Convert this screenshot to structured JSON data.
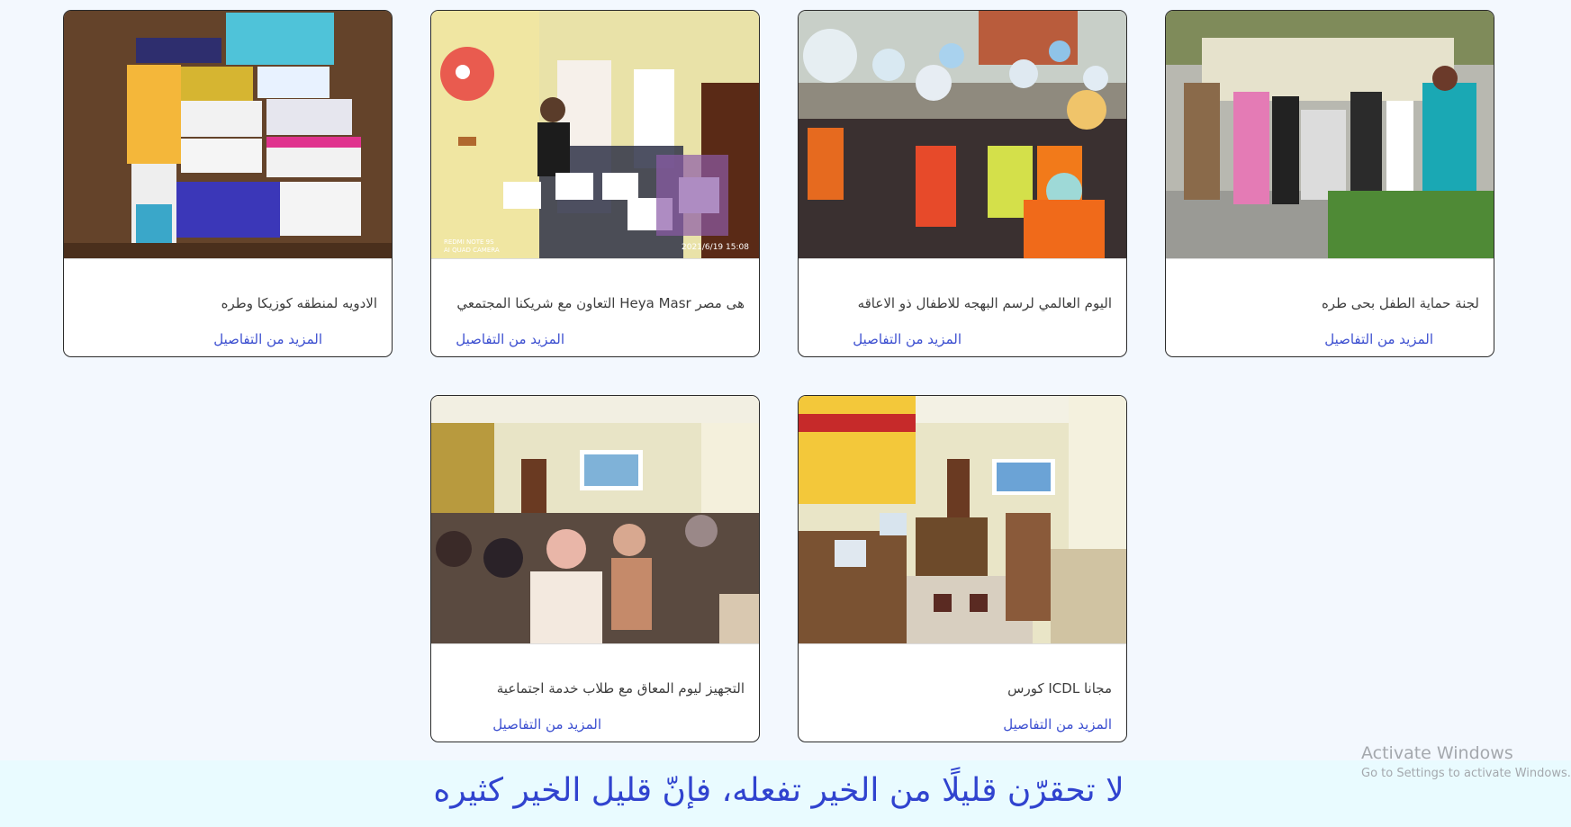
{
  "cards": [
    {
      "title": "الادويه لمنطقه كوزيكا وطره",
      "more_label": "المزيد من التفاصيل",
      "image": "medicine-boxes-photo"
    },
    {
      "title": "هى مصر Heya Masr التعاون مع شريكنا المجتمعي",
      "more_label": "المزيد من التفاصيل",
      "image": "children-certificates-photo",
      "photo_stamp_left": "REDMI NOTE 9S\nAI QUAD CAMERA",
      "photo_stamp_right": "2021/6/19 15:08"
    },
    {
      "title": "اليوم العالمي لرسم البهجه للاطفال ذو الاعاقه",
      "more_label": "المزيد من التفاصيل",
      "image": "balloons-celebration-photo"
    },
    {
      "title": "لجنة حماية الطفل بحى طره",
      "more_label": "المزيد من التفاصيل",
      "image": "committee-group-photo"
    },
    {
      "title": "التجهيز ليوم المعاق مع طلاب خدمة اجتماعية",
      "more_label": "المزيد من التفاصيل",
      "image": "students-lecture-photo"
    },
    {
      "title": "مجانا ICDL كورس",
      "more_label": "المزيد من التفاصيل",
      "image": "computer-lab-photo"
    }
  ],
  "footer": {
    "quote": "لا تحقرّن قليلًا من الخير تفعله، فإنّ قليل الخير كثيره"
  },
  "watermark": {
    "line1": "Activate Windows",
    "line2": "Go to Settings to activate Windows."
  },
  "colors": {
    "link": "#3c4fd0",
    "quote": "#3043cf",
    "page_background": "#f3f8fe",
    "quote_band": "#e9fbff"
  }
}
